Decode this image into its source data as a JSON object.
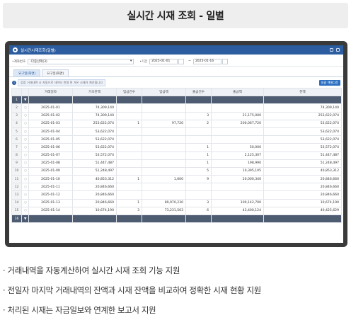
{
  "header": {
    "title": "실시간 시재 조회 - 일별"
  },
  "app": {
    "window_title": "실시간시재조회(일별)",
    "filter": {
      "account_label": "•계좌번호",
      "account_value": "-다중선택(3)",
      "period_label": "•기간",
      "date_from": "2025-01-01",
      "date_to": "2025-01-16",
      "separator": "~"
    },
    "tabs": [
      {
        "label": "요구일(화면)"
      },
      {
        "label": "요구일(화면)"
      }
    ],
    "info_text": "검증 거래내역 시 자동으로 데이터 반영 된 거은 시재가 계산됩니다",
    "excel_button": "일괄 엑셀다운",
    "columns": [
      "거래일자",
      "기초잔액",
      "입금건수",
      "입금액",
      "출금건수",
      "출금액",
      "잔액"
    ],
    "rows": [
      {
        "no": "1",
        "date": "",
        "opening": "",
        "in_cnt": "",
        "in_amt": "",
        "out_cnt": "",
        "out_amt": "",
        "balance": ""
      },
      {
        "no": "2",
        "date": "2025-01-01",
        "opening": "74,309,140",
        "in_cnt": "",
        "in_amt": "",
        "out_cnt": "",
        "out_amt": "",
        "balance": "74,309,140"
      },
      {
        "no": "3",
        "date": "2025-01-02",
        "opening": "74,309,140",
        "in_cnt": "",
        "in_amt": "",
        "out_cnt": "3",
        "out_amt": "21,175,000",
        "balance": "253,622,074"
      },
      {
        "no": "4",
        "date": "2025-01-03",
        "opening": "253,622,074",
        "in_cnt": "1",
        "in_amt": "97,720",
        "out_cnt": "2",
        "out_amt": "200,067,720",
        "balance": "53,622,074"
      },
      {
        "no": "5",
        "date": "2025-01-04",
        "opening": "53,622,074",
        "in_cnt": "",
        "in_amt": "",
        "out_cnt": "",
        "out_amt": "",
        "balance": "53,622,074"
      },
      {
        "no": "6",
        "date": "2025-01-05",
        "opening": "53,622,074",
        "in_cnt": "",
        "in_amt": "",
        "out_cnt": "",
        "out_amt": "",
        "balance": "53,622,074"
      },
      {
        "no": "7",
        "date": "2025-01-06",
        "opening": "53,622,074",
        "in_cnt": "",
        "in_amt": "",
        "out_cnt": "1",
        "out_amt": "50,000",
        "balance": "53,572,074"
      },
      {
        "no": "8",
        "date": "2025-01-07",
        "opening": "53,572,074",
        "in_cnt": "",
        "in_amt": "",
        "out_cnt": "1",
        "out_amt": "2,125,307",
        "balance": "51,447,487"
      },
      {
        "no": "9",
        "date": "2025-01-08",
        "opening": "51,447,487",
        "in_cnt": "",
        "in_amt": "",
        "out_cnt": "1",
        "out_amt": "198,990",
        "balance": "51,248,497"
      },
      {
        "no": "10",
        "date": "2025-01-09",
        "opening": "51,248,497",
        "in_cnt": "",
        "in_amt": "",
        "out_cnt": "5",
        "out_amt": "10,395,105",
        "balance": "40,853,312"
      },
      {
        "no": "11",
        "date": "2025-01-10",
        "opening": "40,853,312",
        "in_cnt": "1",
        "in_amt": "1,600",
        "out_cnt": "9",
        "out_amt": "20,000,340",
        "balance": "20,846,660"
      },
      {
        "no": "12",
        "date": "2025-01-11",
        "opening": "20,846,660",
        "in_cnt": "",
        "in_amt": "",
        "out_cnt": "",
        "out_amt": "",
        "balance": "20,846,660"
      },
      {
        "no": "13",
        "date": "2025-01-12",
        "opening": "20,846,660",
        "in_cnt": "",
        "in_amt": "",
        "out_cnt": "",
        "out_amt": "",
        "balance": "20,846,660"
      },
      {
        "no": "14",
        "date": "2025-01-13",
        "opening": "20,846,660",
        "in_cnt": "1",
        "in_amt": "89,970,230",
        "out_cnt": "3",
        "out_amt": "100,142,700",
        "balance": "10,674,190"
      },
      {
        "no": "15",
        "date": "2025-01-14",
        "opening": "10,674,190",
        "in_cnt": "3",
        "in_amt": "73,231,563",
        "out_cnt": "6",
        "out_amt": "43,400,124",
        "balance": "40,425,629"
      },
      {
        "no": "16",
        "date": "",
        "opening": "",
        "in_cnt": "",
        "in_amt": "",
        "out_cnt": "",
        "out_amt": "",
        "balance": ""
      }
    ]
  },
  "bullets": [
    "· 거래내역을 자동계산하여 실시간 시재 조회 기능 지원",
    "· 전일자 마지막 거래내역의 잔액과 시재 잔액을 비교하여 정확한 시재 현황 지원",
    "· 처리된 시재는 자금일보와 연계한 보고서 지원"
  ]
}
